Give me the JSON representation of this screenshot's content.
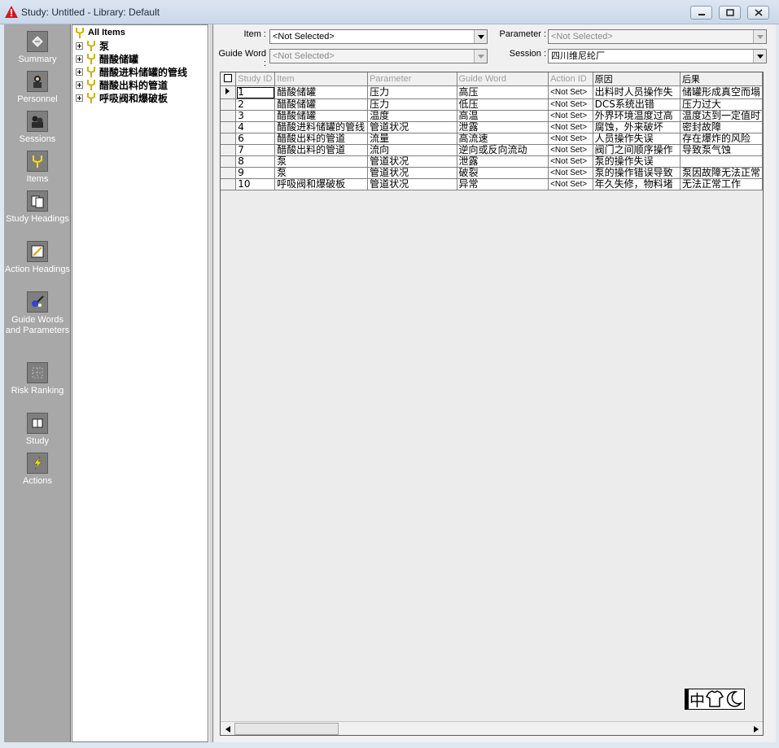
{
  "window": {
    "title": "Study: Untitled - Library: Default"
  },
  "nav": {
    "items": [
      {
        "label": "Summary",
        "icon": "summary-icon"
      },
      {
        "label": "Personnel",
        "icon": "personnel-icon"
      },
      {
        "label": "Sessions",
        "icon": "sessions-icon"
      },
      {
        "label": "Items",
        "icon": "items-icon"
      },
      {
        "label": "Study Headings",
        "icon": "study-headings-icon"
      },
      {
        "label": "Action Headings",
        "icon": "action-headings-icon"
      },
      {
        "label": "Guide Words and Parameters",
        "icon": "guide-words-icon"
      },
      {
        "label": "Risk Ranking",
        "icon": "risk-ranking-icon"
      },
      {
        "label": "Study",
        "icon": "study-icon"
      },
      {
        "label": "Actions",
        "icon": "actions-icon"
      }
    ]
  },
  "tree": {
    "root": "All Items",
    "items": [
      "泵",
      "醋酸储罐",
      "醋酸进料储罐的管线",
      "醋酸出料的管道",
      "呼吸阀和爆破板"
    ]
  },
  "filters": {
    "item_label": "Item :",
    "item_value": "<Not Selected>",
    "guide_word_label": "Guide Word :",
    "guide_word_value": "<Not Selected>",
    "parameter_label": "Parameter :",
    "parameter_value": "<Not Selected>",
    "session_label": "Session :",
    "session_value": "四川维尼纶厂"
  },
  "grid": {
    "columns": [
      "Study ID",
      "Item",
      "Parameter",
      "Guide Word",
      "Action ID",
      "原因",
      "后果"
    ],
    "rows": [
      [
        "1",
        "醋酸储罐",
        "压力",
        "高压",
        "<Not Set>",
        "出料时人员操作失",
        "储罐形成真空而塌"
      ],
      [
        "2",
        "醋酸储罐",
        "压力",
        "低压",
        "<Not Set>",
        "DCS系统出错",
        "压力过大"
      ],
      [
        "3",
        "醋酸储罐",
        "温度",
        "高温",
        "<Not Set>",
        "外界环境温度过高",
        "温度达到一定值时"
      ],
      [
        "4",
        "醋酸进料储罐的管线",
        "管道状况",
        "泄露",
        "<Not Set>",
        "腐蚀，外来破坏",
        "密封故障"
      ],
      [
        "6",
        "醋酸出料的管道",
        "流量",
        "高流速",
        "<Not Set>",
        "人员操作失误",
        "存在爆炸的风险"
      ],
      [
        "7",
        "醋酸出料的管道",
        "流向",
        "逆向或反向流动",
        "<Not Set>",
        "阀门之间顺序操作",
        "导致泵气蚀"
      ],
      [
        "8",
        "泵",
        "管道状况",
        "泄露",
        "<Not Set>",
        "泵的操作失误",
        ""
      ],
      [
        "9",
        "泵",
        "管道状况",
        "破裂",
        "<Not Set>",
        "泵的操作错误导致",
        "泵因故障无法正常"
      ],
      [
        "10",
        "呼吸阀和爆破板",
        "管道状况",
        "异常",
        "<Not Set>",
        "年久失修，物料堵",
        "无法正常工作"
      ]
    ]
  },
  "ime": {
    "mode": "中"
  }
}
